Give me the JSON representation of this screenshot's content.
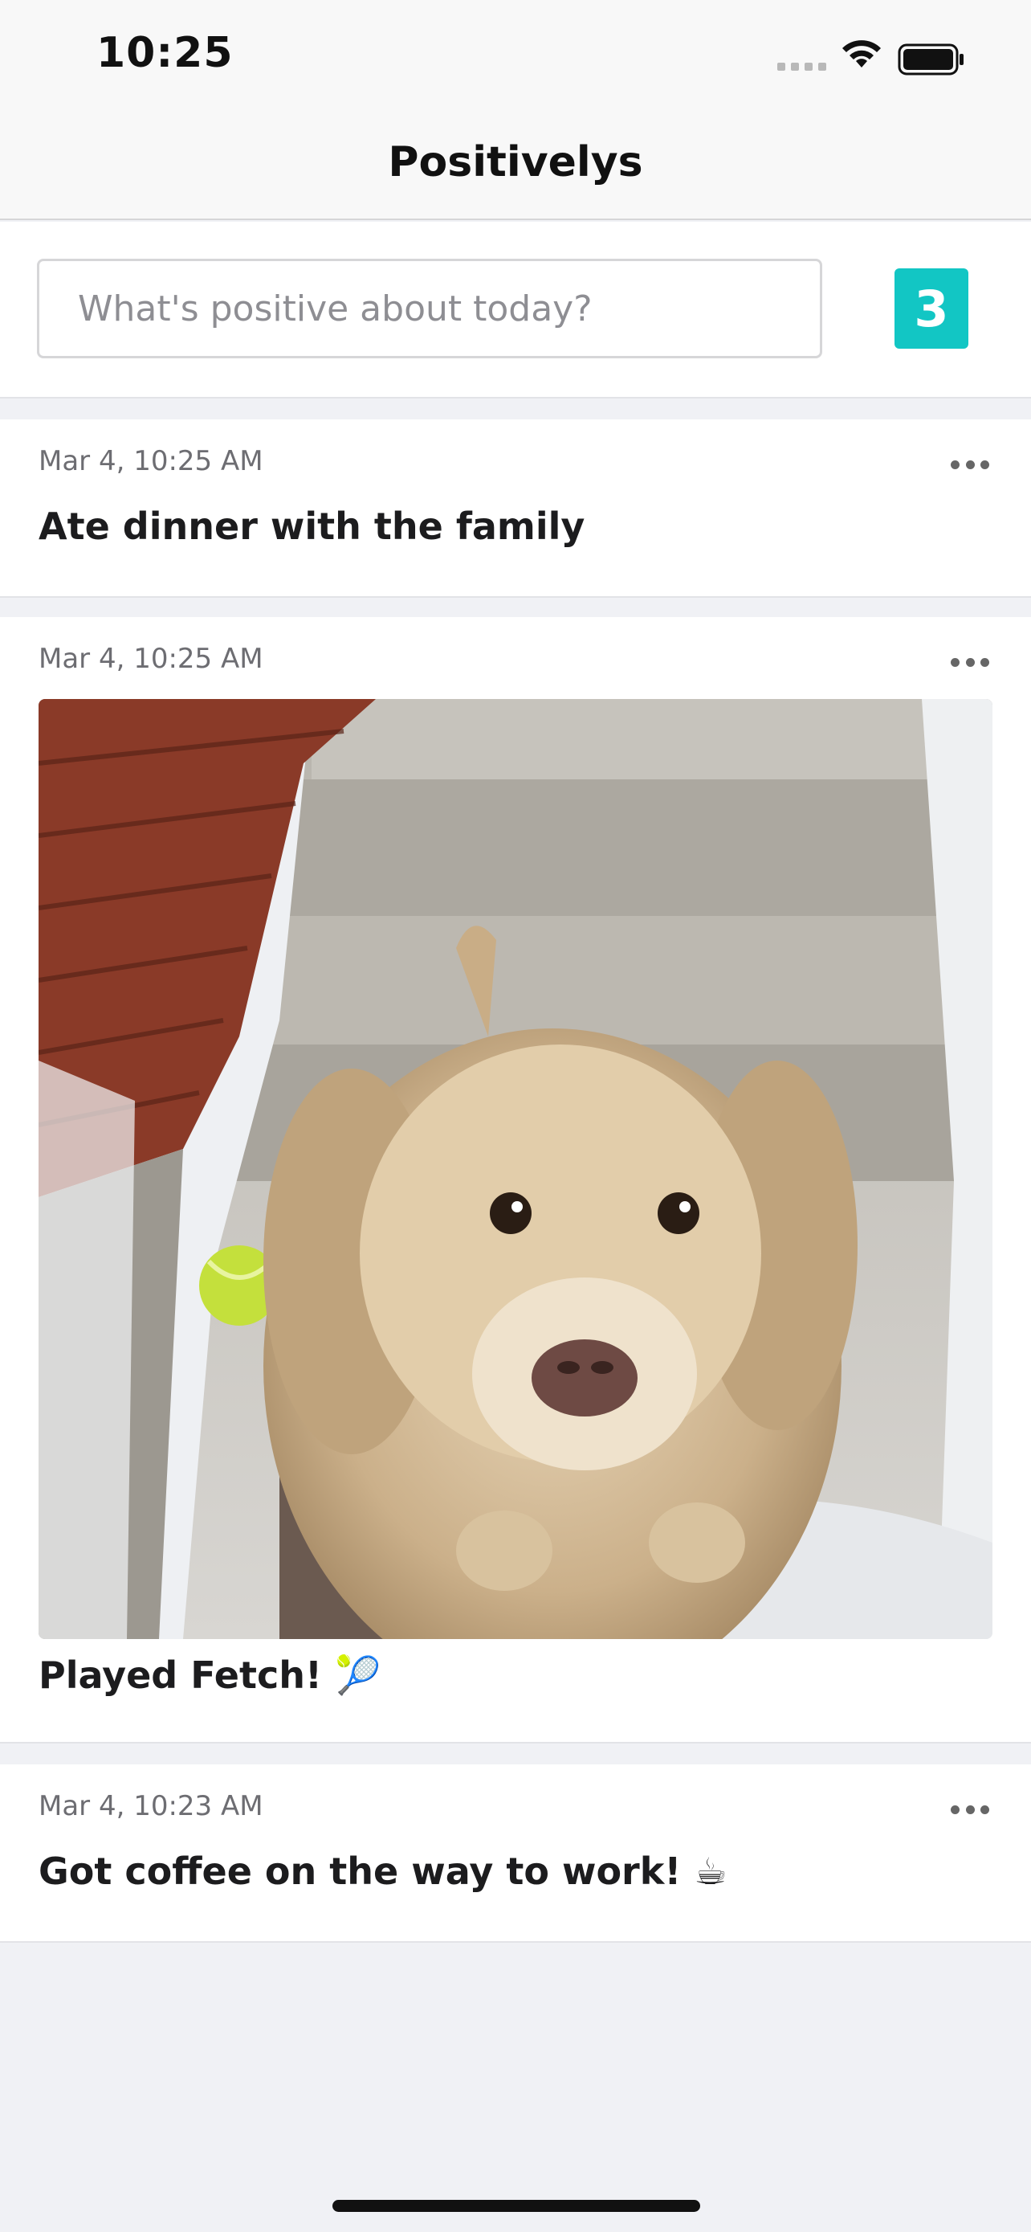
{
  "status_bar": {
    "time": "10:25"
  },
  "nav": {
    "title": "Positivelys"
  },
  "compose": {
    "placeholder": "What's positive about today?",
    "count": "3"
  },
  "entries": [
    {
      "timestamp": "Mar 4, 10:25 AM",
      "text": "Ate dinner with the family"
    },
    {
      "timestamp": "Mar 4, 10:25 AM",
      "text": "Played Fetch! 🎾",
      "has_photo": true,
      "photo_alt": "dog-on-snowy-steps"
    },
    {
      "timestamp": "Mar 4, 10:23 AM",
      "text": "Got coffee on the way to work! ☕"
    }
  ],
  "icons": {
    "signal": "cellular-signal-icon",
    "wifi": "wifi-icon",
    "battery": "battery-icon",
    "more": "more-dots-icon"
  },
  "colors": {
    "accent": "#12c6c4",
    "background": "#f0f1f5"
  }
}
